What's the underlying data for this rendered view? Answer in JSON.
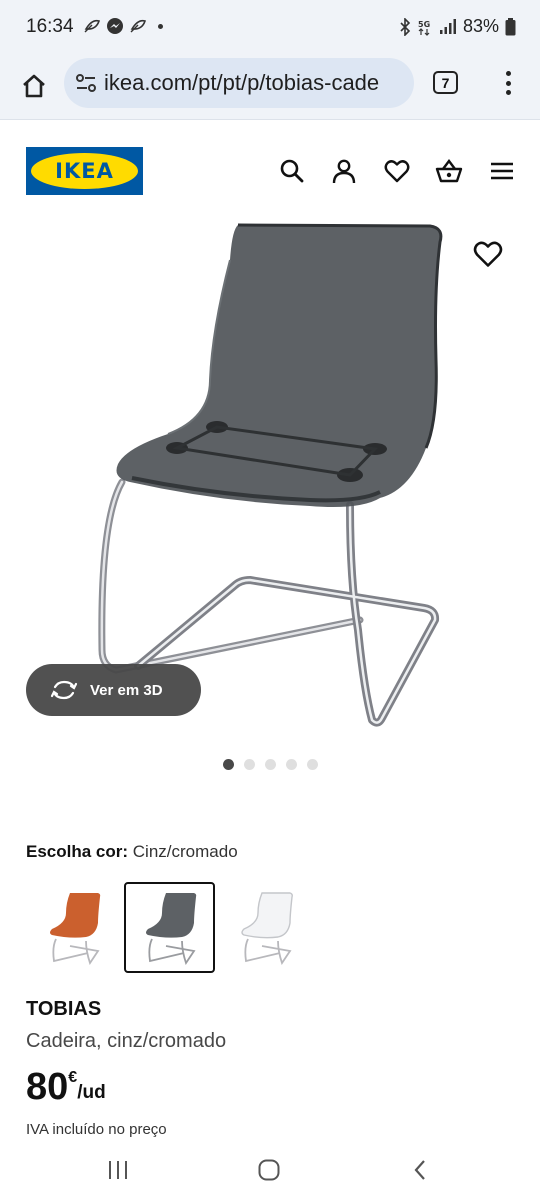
{
  "status_bar": {
    "time": "16:34",
    "battery": "83%",
    "notification_icons": [
      "leaf-icon",
      "messenger-icon",
      "leaf-icon",
      "dot-icon"
    ]
  },
  "browser": {
    "url": "ikea.com/pt/pt/p/tobias-cade",
    "tab_count": "7"
  },
  "header": {
    "logo_text": "IKEA",
    "icons": [
      "search-icon",
      "user-icon",
      "heart-icon",
      "basket-icon",
      "hamburger-icon"
    ]
  },
  "gallery": {
    "view_3d_label": "Ver em 3D",
    "dot_count": 5,
    "active_dot": 0
  },
  "product": {
    "color_label": "Escolha cor:",
    "color_value": "Cinz/cromado",
    "swatches": [
      "orange",
      "grey",
      "transparent"
    ],
    "selected_swatch": 1,
    "name": "TOBIAS",
    "description": "Cadeira, cinz/cromado",
    "price_int": "80",
    "price_currency": "€",
    "price_unit": "/ud",
    "vat_note": "IVA incluído no preço"
  },
  "colors": {
    "ikea_blue": "#0058a3",
    "ikea_yellow": "#ffdb00"
  }
}
